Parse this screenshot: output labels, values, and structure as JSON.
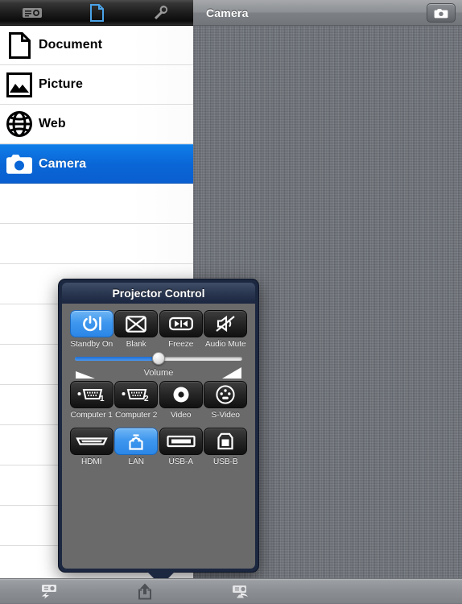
{
  "toolbar_top_left": {
    "tabs": [
      {
        "name": "projector-tab",
        "icon": "projector-icon",
        "active": false
      },
      {
        "name": "document-tab",
        "icon": "document-icon",
        "active": true
      },
      {
        "name": "settings-tab",
        "icon": "wrench-icon",
        "active": false
      }
    ]
  },
  "content_pane": {
    "title": "Camera",
    "camera_button_icon": "camera-icon"
  },
  "sidebar": {
    "items": [
      {
        "label": "Document",
        "icon": "document-icon",
        "selected": false
      },
      {
        "label": "Picture",
        "icon": "picture-icon",
        "selected": false
      },
      {
        "label": "Web",
        "icon": "globe-icon",
        "selected": false
      },
      {
        "label": "Camera",
        "icon": "camera-icon",
        "selected": true
      }
    ],
    "empty_rows": 9,
    "selection_color": "#0a66d6"
  },
  "toolbar_bottom": {
    "buttons": [
      {
        "name": "project-icon",
        "label": ""
      },
      {
        "name": "share-icon",
        "label": ""
      },
      {
        "name": "projector-control-icon",
        "label": ""
      }
    ]
  },
  "projector_control": {
    "title": "Projector Control",
    "accent_color": "#2b86e6",
    "panel_color": "#6a6a6a",
    "border_color": "#1c2740",
    "row1": [
      {
        "label": "Standby On",
        "icon": "power-icon",
        "active": true
      },
      {
        "label": "Blank",
        "icon": "blank-screen-icon",
        "active": false
      },
      {
        "label": "Freeze",
        "icon": "freeze-icon",
        "active": false
      },
      {
        "label": "Audio Mute",
        "icon": "audio-mute-icon",
        "active": false
      }
    ],
    "volume": {
      "label": "Volume",
      "value": 50,
      "min_icon": "volume-low-icon",
      "max_icon": "volume-high-icon"
    },
    "row2": [
      {
        "label": "Computer 1",
        "icon": "vga-1-icon",
        "active": false
      },
      {
        "label": "Computer 2",
        "icon": "vga-2-icon",
        "active": false
      },
      {
        "label": "Video",
        "icon": "composite-video-icon",
        "active": false
      },
      {
        "label": "S-Video",
        "icon": "s-video-icon",
        "active": false
      }
    ],
    "row3": [
      {
        "label": "HDMI",
        "icon": "hdmi-icon",
        "active": false
      },
      {
        "label": "LAN",
        "icon": "lan-icon",
        "active": true
      },
      {
        "label": "USB-A",
        "icon": "usb-a-icon",
        "active": false
      },
      {
        "label": "USB-B",
        "icon": "usb-b-icon",
        "active": false
      }
    ]
  }
}
